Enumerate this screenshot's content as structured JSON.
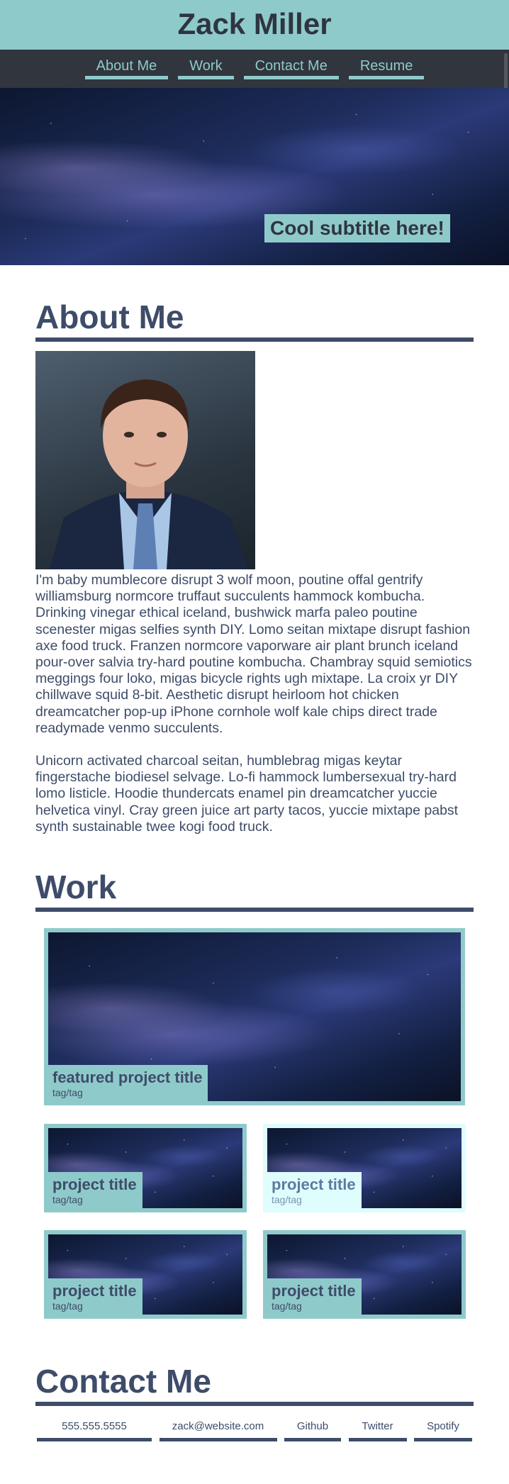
{
  "header": {
    "title": "Zack Miller"
  },
  "nav": {
    "items": [
      "About Me",
      "Work",
      "Contact Me",
      "Resume"
    ]
  },
  "hero": {
    "subtitle": "Cool subtitle here!"
  },
  "about": {
    "heading": "About Me",
    "paragraphs": [
      "I'm baby mumblecore disrupt 3 wolf moon, poutine offal gentrify williamsburg normcore truffaut succulents hammock kombucha. Drinking vinegar ethical iceland, bushwick marfa paleo poutine scenester migas selfies synth DIY. Lomo seitan mixtape disrupt fashion axe food truck. Franzen normcore vaporware air plant brunch iceland pour-over salvia try-hard poutine kombucha. Chambray squid semiotics meggings four loko, migas bicycle rights ugh mixtape. La croix yr DIY chillwave squid 8-bit. Aesthetic disrupt heirloom hot chicken dreamcatcher pop-up iPhone cornhole wolf kale chips direct trade readymade venmo succulents.",
      "Unicorn activated charcoal seitan, humblebrag migas keytar fingerstache biodiesel selvage. Lo-fi hammock lumbersexual try-hard lomo listicle. Hoodie thundercats enamel pin dreamcatcher yuccie helvetica vinyl. Cray green juice art party tacos, yuccie mixtape pabst synth sustainable twee kogi food truck."
    ]
  },
  "work": {
    "heading": "Work",
    "featured": {
      "title": "featured project title",
      "tags": "tag/tag"
    },
    "projects": [
      {
        "title": "project title",
        "tags": "tag/tag"
      },
      {
        "title": "project title",
        "tags": "tag/tag"
      },
      {
        "title": "project title",
        "tags": "tag/tag"
      },
      {
        "title": "project title",
        "tags": "tag/tag"
      }
    ]
  },
  "contact": {
    "heading": "Contact Me",
    "links": [
      "555.555.5555",
      "zack@website.com",
      "Github",
      "Twitter",
      "Spotify"
    ]
  },
  "colors": {
    "accent": "#8fcacb",
    "nav_background": "#31353d",
    "heading": "#3e4c69",
    "hover_card": "#dffdfd"
  }
}
